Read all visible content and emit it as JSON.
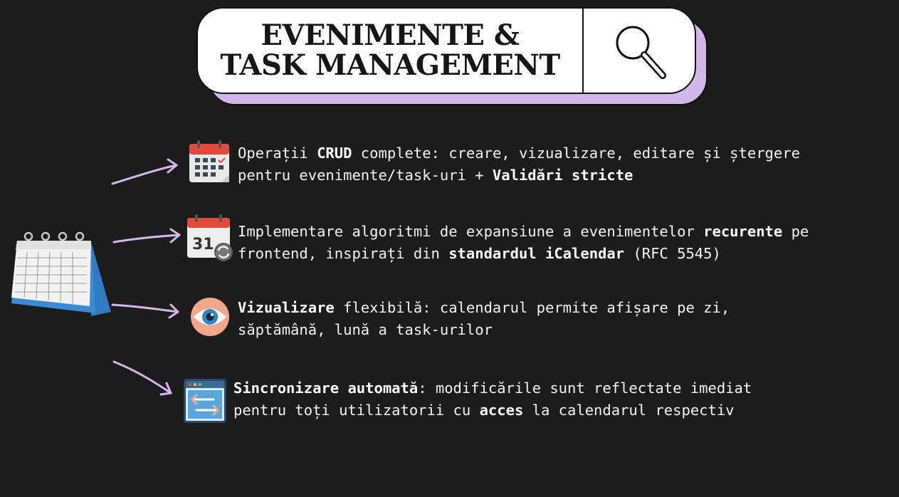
{
  "title": {
    "line1": "EVENIMENTE &",
    "line2": "TASK MANAGEMENT"
  },
  "items": [
    {
      "icon": "calendar-icon",
      "lines": [
        [
          {
            "t": "Operații ",
            "b": false
          },
          {
            "t": "CRUD",
            "b": true
          },
          {
            "t": " complete: creare, vizualizare, editare și ștergere",
            "b": false
          }
        ],
        [
          {
            "t": "pentru evenimente/task-uri + ",
            "b": false
          },
          {
            "t": "Validări stricte",
            "b": true
          }
        ]
      ]
    },
    {
      "icon": "recurring-calendar-icon",
      "lines": [
        [
          {
            "t": "Implementare algoritmi de expansiune a evenimentelor ",
            "b": false
          },
          {
            "t": "recurente",
            "b": true
          },
          {
            "t": " pe",
            "b": false
          }
        ],
        [
          {
            "t": "frontend, inspirați din ",
            "b": false
          },
          {
            "t": "standardul iCalendar",
            "b": true
          },
          {
            "t": " (RFC 5545)",
            "b": false
          }
        ]
      ]
    },
    {
      "icon": "eye-icon",
      "lines": [
        [
          {
            "t": "Vizualizare",
            "b": true
          },
          {
            "t": " flexibilă: calendarul permite afișare pe zi,",
            "b": false
          }
        ],
        [
          {
            "t": "săptămână, lună a task-urilor",
            "b": false
          }
        ]
      ]
    },
    {
      "icon": "sync-window-icon",
      "lines": [
        [
          {
            "t": "Sincronizare automată",
            "b": true
          },
          {
            "t": ": modificările sunt reflectate imediat",
            "b": false
          }
        ],
        [
          {
            "t": "pentru toți utilizatorii cu ",
            "b": false
          },
          {
            "t": "acces",
            "b": true
          },
          {
            "t": " la calendarul respectiv",
            "b": false
          }
        ]
      ]
    }
  ],
  "colors": {
    "background": "#1c1c1c",
    "accent_lavender": "#d3b6ea",
    "text": "#ffffff"
  }
}
